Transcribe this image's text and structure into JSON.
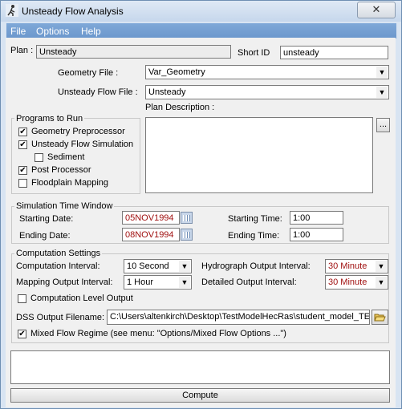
{
  "window": {
    "title": "Unsteady Flow Analysis",
    "close_glyph": "✕",
    "app_icon": "runner-icon"
  },
  "menu": [
    "File",
    "Options",
    "Help"
  ],
  "plan": {
    "label": "Plan :",
    "value": "Unsteady",
    "short_id_label": "Short ID",
    "short_id_value": "unsteady"
  },
  "geometry_file": {
    "label": "Geometry File :",
    "value": "Var_Geometry"
  },
  "unsteady_flow_file": {
    "label": "Unsteady Flow File :",
    "value": "Unsteady"
  },
  "programs": {
    "title": "Programs to Run",
    "items": [
      {
        "label": "Geometry Preprocessor",
        "checked": true
      },
      {
        "label": "Unsteady Flow Simulation",
        "checked": true
      },
      {
        "label": "Sediment",
        "checked": false
      },
      {
        "label": "Post Processor",
        "checked": true
      },
      {
        "label": "Floodplain Mapping",
        "checked": false
      }
    ]
  },
  "plan_description": {
    "label": "Plan Description :",
    "value": "",
    "browse_label": "..."
  },
  "time_window": {
    "title": "Simulation Time Window",
    "starting_date_label": "Starting Date:",
    "starting_date": "05NOV1994",
    "ending_date_label": "Ending Date:",
    "ending_date": "08NOV1994",
    "starting_time_label": "Starting Time:",
    "starting_time": "1:00",
    "ending_time_label": "Ending Time:",
    "ending_time": "1:00"
  },
  "computation": {
    "title": "Computation Settings",
    "computation_interval_label": "Computation Interval:",
    "computation_interval": "10 Second",
    "hydrograph_interval_label": "Hydrograph Output Interval:",
    "hydrograph_interval": "30 Minute",
    "mapping_interval_label": "Mapping Output Interval:",
    "mapping_interval": "1 Hour",
    "detailed_interval_label": "Detailed Output Interval:",
    "detailed_interval": "30 Minute",
    "level_output_label": "Computation Level Output",
    "level_output_checked": false,
    "dss_label": "DSS Output Filename:",
    "dss_value": "C:\\Users\\altenkirch\\Desktop\\TestModelHecRas\\student_model_TES",
    "mixed_flow_label": "Mixed Flow Regime (see menu: \"Options/Mixed Flow Options ...\")",
    "mixed_flow_checked": true
  },
  "message_area": "",
  "compute_button": "Compute",
  "colors": {
    "accent": "#6b97cc",
    "date_text": "#a01010"
  }
}
